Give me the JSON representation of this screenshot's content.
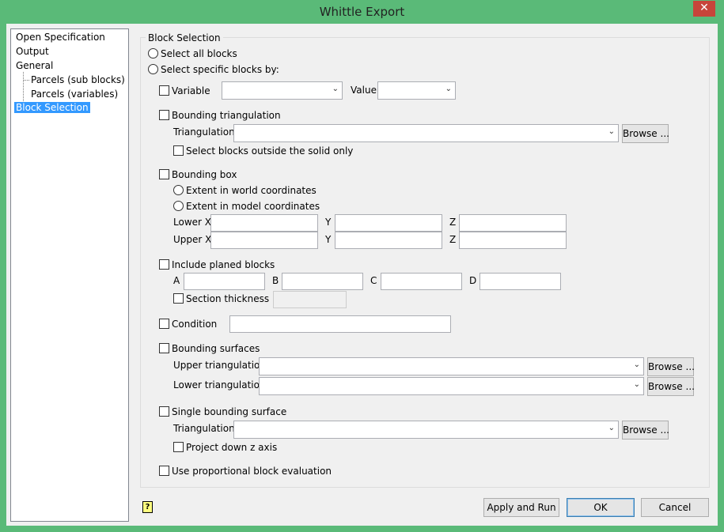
{
  "window": {
    "title": "Whittle Export",
    "close": "✕"
  },
  "tree": [
    "Open Specification",
    "Output",
    "General",
    "Parcels (sub blocks)",
    "Parcels (variables)",
    "Block Selection"
  ],
  "group_title": "Block Selection",
  "select_all": "Select all blocks",
  "select_specific": "Select specific blocks by:",
  "variable": {
    "label": "Variable",
    "value_label": "Value"
  },
  "bounding_triangulation": {
    "label": "Bounding triangulation",
    "triangulation": "Triangulation",
    "browse": "Browse ...",
    "outside": "Select blocks outside the solid only"
  },
  "bounding_box": {
    "label": "Bounding box",
    "world": "Extent in world coordinates",
    "model": "Extent in model coordinates",
    "lower_x": "Lower X",
    "upper_x": "Upper X",
    "y": "Y",
    "z": "Z"
  },
  "planed": {
    "label": "Include planed blocks",
    "a": "A",
    "b": "B",
    "c": "C",
    "d": "D",
    "section": "Section thickness"
  },
  "condition": "Condition",
  "bounding_surfaces": {
    "label": "Bounding surfaces",
    "upper": "Upper triangulation",
    "lower": "Lower triangulation",
    "browse": "Browse ..."
  },
  "single_surface": {
    "label": "Single bounding surface",
    "triangulation": "Triangulation",
    "browse": "Browse ...",
    "project": "Project down z axis"
  },
  "proportional": "Use proportional block evaluation",
  "footer": {
    "help": "?",
    "apply": "Apply and Run",
    "ok": "OK",
    "cancel": "Cancel"
  }
}
